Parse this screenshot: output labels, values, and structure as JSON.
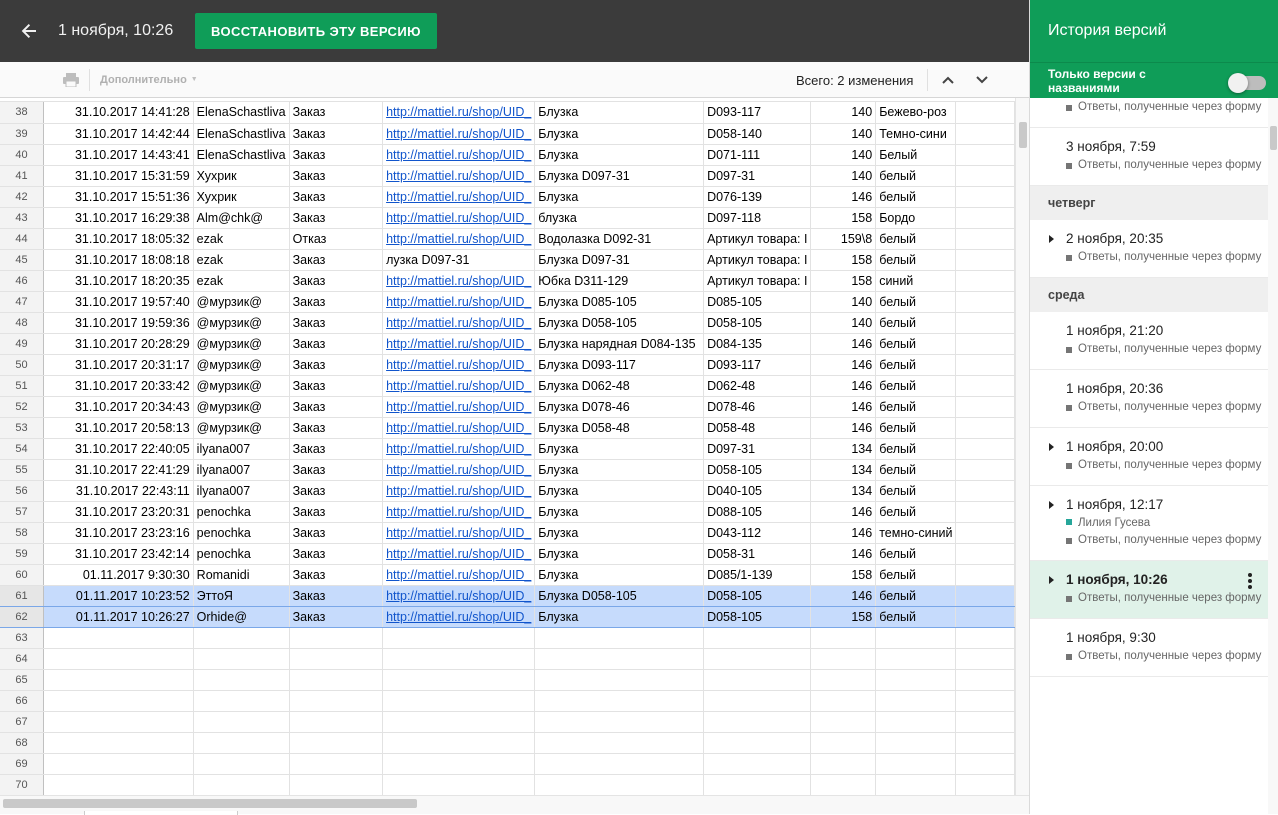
{
  "topbar": {
    "version_date": "1 ноября, 10:26",
    "restore_label": "ВОССТАНОВИТЬ ЭТУ ВЕРСИЮ"
  },
  "toolbar": {
    "more_label": "Дополнительно",
    "changes_count": "Всего: 2 изменения"
  },
  "sheet": {
    "rows": [
      [
        "38",
        "31.10.2017 14:41:28",
        "ElenaSchastliva",
        "Заказ",
        "http://mattiel.ru/shop/UID_",
        "Блузка",
        "D093-117",
        "140",
        "Бежево-роз"
      ],
      [
        "39",
        "31.10.2017 14:42:44",
        "ElenaSchastliva",
        "Заказ",
        "http://mattiel.ru/shop/UID_",
        "Блузка",
        "D058-140",
        "140",
        "Темно-сини"
      ],
      [
        "40",
        "31.10.2017 14:43:41",
        "ElenaSchastliva",
        "Заказ",
        "http://mattiel.ru/shop/UID_",
        "Блузка",
        "D071-111",
        "140",
        "Белый"
      ],
      [
        "41",
        "31.10.2017 15:31:59",
        "Хухрик",
        "Заказ",
        "http://mattiel.ru/shop/UID_",
        "Блузка D097-31",
        "D097-31",
        "140",
        "белый"
      ],
      [
        "42",
        "31.10.2017 15:51:36",
        "Хухрик",
        "Заказ",
        "http://mattiel.ru/shop/UID_",
        "Блузка",
        "D076-139",
        "146",
        "белый"
      ],
      [
        "43",
        "31.10.2017 16:29:38",
        "Alm@chk@",
        "Заказ",
        "http://mattiel.ru/shop/UID_",
        "блузка",
        "D097-118",
        "158",
        "Бордо"
      ],
      [
        "44",
        "31.10.2017 18:05:32",
        "ezak",
        "Отказ",
        "http://mattiel.ru/shop/UID_",
        "Водолазка D092-31",
        "Артикул товара: I",
        "159\\8",
        "белый"
      ],
      [
        "45",
        "31.10.2017 18:08:18",
        "ezak",
        "Заказ",
        "лузка D097-31",
        "Блузка D097-31",
        "Артикул товара: I",
        "158",
        "белый"
      ],
      [
        "46",
        "31.10.2017 18:20:35",
        "ezak",
        "Заказ",
        "http://mattiel.ru/shop/UID_",
        "Юбка D311-129",
        "Артикул товара: I",
        "158",
        "синий"
      ],
      [
        "47",
        "31.10.2017 19:57:40",
        "@мурзик@",
        "Заказ",
        "http://mattiel.ru/shop/UID_",
        "Блузка D085-105",
        "D085-105",
        "140",
        "белый"
      ],
      [
        "48",
        "31.10.2017 19:59:36",
        "@мурзик@",
        "Заказ",
        "http://mattiel.ru/shop/UID_",
        "Блузка D058-105",
        "D058-105",
        "140",
        "белый"
      ],
      [
        "49",
        "31.10.2017 20:28:29",
        "@мурзик@",
        "Заказ",
        "http://mattiel.ru/shop/UID_",
        "Блузка нарядная D084-135",
        "D084-135",
        "146",
        "белый"
      ],
      [
        "50",
        "31.10.2017 20:31:17",
        "@мурзик@",
        "Заказ",
        "http://mattiel.ru/shop/UID_",
        "Блузка D093-117",
        "D093-117",
        "146",
        "белый"
      ],
      [
        "51",
        "31.10.2017 20:33:42",
        "@мурзик@",
        "Заказ",
        "http://mattiel.ru/shop/UID_",
        "Блузка D062-48",
        "D062-48",
        "146",
        "белый"
      ],
      [
        "52",
        "31.10.2017 20:34:43",
        "@мурзик@",
        "Заказ",
        "http://mattiel.ru/shop/UID_",
        "Блузка D078-46",
        "D078-46",
        "146",
        "белый"
      ],
      [
        "53",
        "31.10.2017 20:58:13",
        "@мурзик@",
        "Заказ",
        "http://mattiel.ru/shop/UID_",
        "Блузка D058-48",
        "D058-48",
        "146",
        "белый"
      ],
      [
        "54",
        "31.10.2017 22:40:05",
        "ilyana007",
        "Заказ",
        "http://mattiel.ru/shop/UID_",
        "Блузка",
        "D097-31",
        "134",
        "белый"
      ],
      [
        "55",
        "31.10.2017 22:41:29",
        "ilyana007",
        "Заказ",
        "http://mattiel.ru/shop/UID_",
        "Блузка",
        "D058-105",
        "134",
        "белый"
      ],
      [
        "56",
        "31.10.2017 22:43:11",
        "ilyana007",
        "Заказ",
        "http://mattiel.ru/shop/UID_",
        "Блузка",
        "D040-105",
        "134",
        "белый"
      ],
      [
        "57",
        "31.10.2017 23:20:31",
        "penochka",
        "Заказ",
        "http://mattiel.ru/shop/UID_",
        "Блузка",
        "D088-105",
        "146",
        "белый"
      ],
      [
        "58",
        "31.10.2017 23:23:16",
        "penochka",
        "Заказ",
        "http://mattiel.ru/shop/UID_",
        "Блузка",
        "D043-112",
        "146",
        "темно-синий"
      ],
      [
        "59",
        "31.10.2017 23:42:14",
        "penochka",
        "Заказ",
        "http://mattiel.ru/shop/UID_",
        "Блузка",
        "D058-31",
        "146",
        "белый"
      ],
      [
        "60",
        "01.11.2017 9:30:30",
        "Romanidi",
        "Заказ",
        "http://mattiel.ru/shop/UID_",
        "Блузка",
        "D085/1-139",
        "158",
        "белый"
      ],
      [
        "61",
        "01.11.2017 10:23:52",
        "ЭттоЯ",
        "Заказ",
        "http://mattiel.ru/shop/UID_",
        "Блузка D058-105",
        "D058-105",
        "146",
        "белый"
      ],
      [
        "62",
        "01.11.2017 10:26:27",
        "Orhide@",
        "Заказ",
        "http://mattiel.ru/shop/UID_",
        "Блузка",
        "D058-105",
        "158",
        "белый"
      ],
      [
        "63",
        "",
        "",
        "",
        "",
        "",
        "",
        "",
        ""
      ],
      [
        "64",
        "",
        "",
        "",
        "",
        "",
        "",
        "",
        ""
      ],
      [
        "65",
        "",
        "",
        "",
        "",
        "",
        "",
        "",
        ""
      ],
      [
        "66",
        "",
        "",
        "",
        "",
        "",
        "",
        "",
        ""
      ],
      [
        "67",
        "",
        "",
        "",
        "",
        "",
        "",
        "",
        ""
      ],
      [
        "68",
        "",
        "",
        "",
        "",
        "",
        "",
        "",
        ""
      ],
      [
        "69",
        "",
        "",
        "",
        "",
        "",
        "",
        "",
        ""
      ],
      [
        "70",
        "",
        "",
        "",
        "",
        "",
        "",
        "",
        ""
      ]
    ],
    "selected_rows": [
      "61",
      "62"
    ]
  },
  "panel": {
    "title": "История версий",
    "filter_label": "Только версии с названиями",
    "filter_on": false,
    "entries": [
      {
        "kind": "version",
        "title": "",
        "meta": "Ответы, полученные через форму",
        "top": true
      },
      {
        "kind": "version",
        "title": "3 ноября, 7:59",
        "meta": "Ответы, полученные через форму"
      },
      {
        "kind": "day",
        "title": "четверг"
      },
      {
        "kind": "version",
        "title": "2 ноября, 20:35",
        "meta": "Ответы, полученные через форму",
        "expand": true
      },
      {
        "kind": "day",
        "title": "среда"
      },
      {
        "kind": "version",
        "title": "1 ноября, 21:20",
        "meta": "Ответы, полученные через форму"
      },
      {
        "kind": "version",
        "title": "1 ноября, 20:36",
        "meta": "Ответы, полученные через форму"
      },
      {
        "kind": "version",
        "title": "1 ноября, 20:00",
        "meta": "Ответы, полученные через форму",
        "expand": true
      },
      {
        "kind": "version",
        "title": "1 ноября, 12:17",
        "author": "Лилия Гусева",
        "meta": "Ответы, полученные через форму",
        "expand": true
      },
      {
        "kind": "version",
        "title": "1 ноября, 10:26",
        "meta": "Ответы, полученные через форму",
        "expand": true,
        "current": true
      },
      {
        "kind": "version",
        "title": "1 ноября, 9:30",
        "meta": "Ответы, полученные через форму"
      }
    ]
  },
  "colors": {
    "brand_green": "#0f9d58",
    "topbar": "#3b3b3b",
    "selection": "#c6dbfc",
    "author_teal": "#26a69a"
  }
}
